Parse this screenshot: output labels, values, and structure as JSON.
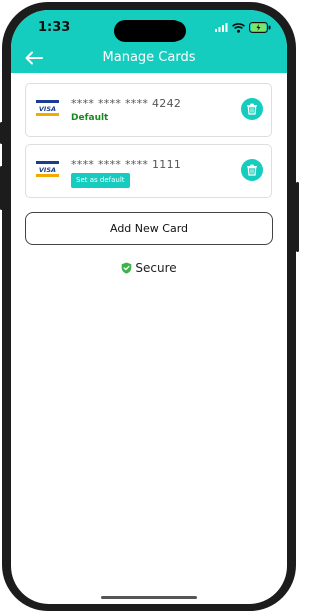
{
  "status": {
    "time": "1:33"
  },
  "header": {
    "title": "Manage Cards"
  },
  "cards": [
    {
      "brand": "VISA",
      "number": "**** **** **** 4242",
      "default_label": "Default"
    },
    {
      "brand": "VISA",
      "number": "**** **** **** 1111",
      "action_label": "Set as default"
    }
  ],
  "add_card_label": "Add New Card",
  "secure_label": "Secure",
  "colors": {
    "accent": "#14cdbf",
    "default_green": "#1a8a20",
    "secure_green": "#3cb34a"
  },
  "icons": [
    "back-arrow-icon",
    "visa-icon",
    "trash-icon",
    "shield-check-icon",
    "signal-icon",
    "wifi-icon",
    "battery-icon"
  ]
}
